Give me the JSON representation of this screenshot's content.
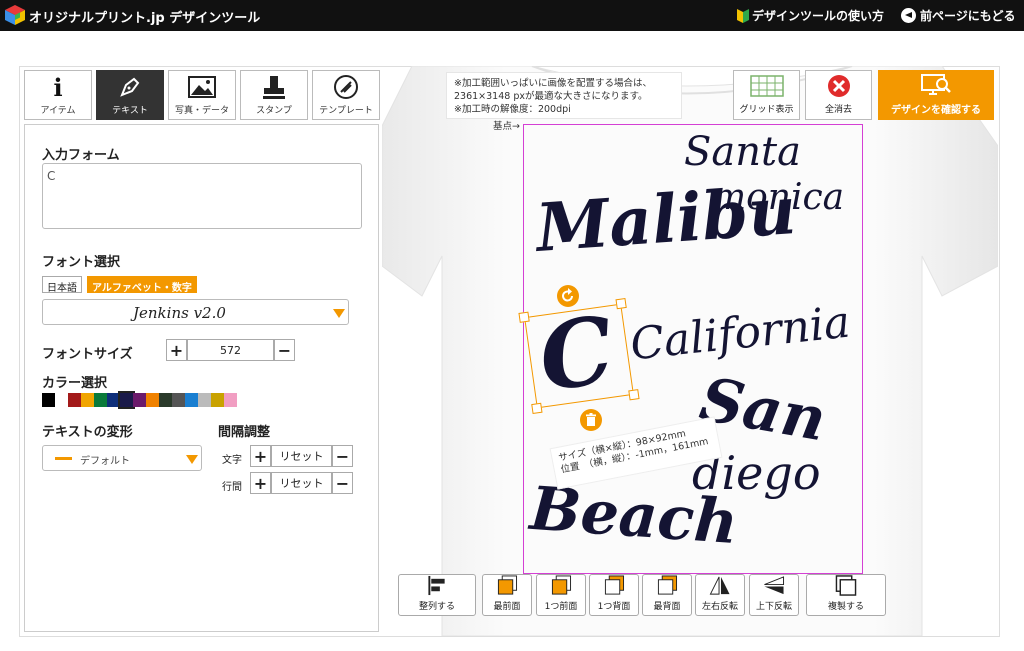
{
  "header": {
    "brand": "オリジナルプリント.jp デザインツール",
    "howto_label": "デザインツールの使い方",
    "back_label": "前ページにもどる"
  },
  "tabs": [
    {
      "label": "アイテム",
      "icon": "info-icon"
    },
    {
      "label": "テキスト",
      "icon": "pen-icon",
      "active": true
    },
    {
      "label": "写真・データ",
      "icon": "image-icon"
    },
    {
      "label": "スタンプ",
      "icon": "stamp-icon"
    },
    {
      "label": "テンプレート",
      "icon": "template-icon"
    }
  ],
  "panel": {
    "input_label": "入力フォーム",
    "input_value": "C",
    "font_select_label": "フォント選択",
    "font_lang_jp": "日本語",
    "font_lang_alpha": "アルファベット・数字",
    "font_name": "Jenkins v2.0",
    "font_size_label": "フォントサイズ",
    "font_size_value": "572",
    "color_label": "カラー選択",
    "colors": [
      "#000000",
      "#ffffff",
      "#a31a1a",
      "#f1a500",
      "#0a7a3a",
      "#0f2f7a",
      "#1a1a4a",
      "#6b1a6b",
      "#f08200",
      "#2a3a2a",
      "#555555",
      "#1a7fd1",
      "#bbbbbb",
      "#c9a200",
      "#f19ec2"
    ],
    "transform_label": "テキストの変形",
    "transform_value": "デフォルト",
    "spacing_label": "間隔調整",
    "char_label": "文字",
    "line_label": "行間",
    "reset_label": "リセット"
  },
  "canvas": {
    "note_lines": [
      "※加工範囲いっぱいに画像を配置する場合は、",
      "2361×3148 pxが最適な大きさになります。",
      "※加工時の解像度：200dpi"
    ],
    "origin_label": "基点→",
    "texts": [
      "Santa",
      "monica",
      "Malibu",
      "California",
      "San",
      "diego",
      "Beach"
    ],
    "selected_letter": "C",
    "size_lines": [
      "サイズ（横×縦）：98×92mm",
      "位置　（横，縦）：-1mm，161mm"
    ]
  },
  "toolbar": {
    "grid_label": "グリッド表示",
    "clear_label": "全消去",
    "confirm_label": "デザインを確認する"
  },
  "bottom": {
    "align": "整列する",
    "front": "最前面",
    "forward": "1つ前面",
    "backward": "1つ背面",
    "back": "最背面",
    "flip_h": "左右反転",
    "flip_v": "上下反転",
    "duplicate": "複製する"
  }
}
